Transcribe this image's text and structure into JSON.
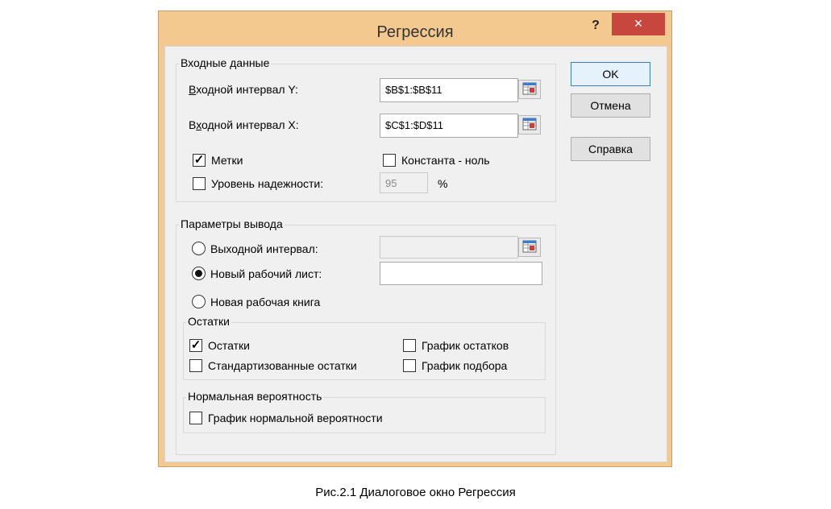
{
  "dialog": {
    "title": "Регрессия",
    "help_glyph": "?",
    "close_glyph": "×"
  },
  "input_group": {
    "label": "Входные данные",
    "y_range_label": "Входной интервал Y:",
    "y_range_value": "$B$1:$B$11",
    "x_range_label": "Входной интервал X:",
    "x_range_value": "$C$1:$D$11",
    "labels_label": "Метки",
    "labels_checked": true,
    "constant_zero_label": "Константа - ноль",
    "constant_zero_checked": false,
    "confidence_label": "Уровень надежности:",
    "confidence_checked": false,
    "confidence_value": "95",
    "percent": "%"
  },
  "output_group": {
    "label": "Параметры вывода",
    "output_range_label": "Выходной интервал:",
    "output_range_value": "",
    "new_sheet_label": "Новый рабочий лист:",
    "new_sheet_value": "",
    "new_workbook_label": "Новая рабочая книга",
    "selected": "new_sheet"
  },
  "residuals_group": {
    "label": "Остатки",
    "residuals_label": "Остатки",
    "residuals_checked": true,
    "standardized_label": "Стандартизованные остатки",
    "standardized_checked": false,
    "residual_plots_label": "График остатков",
    "residual_plots_checked": false,
    "line_fit_label": "График подбора",
    "line_fit_checked": false
  },
  "probability_group": {
    "label": "Нормальная вероятность",
    "normal_plot_label": "График нормальной вероятности",
    "normal_plot_checked": false
  },
  "buttons": {
    "ok": "OK",
    "cancel": "Отмена",
    "help": "Справка"
  },
  "caption": "Рис.2.1 Диалоговое окно Регрессия",
  "colors": {
    "frame": "#f3c98f",
    "close": "#c7473f",
    "client": "#f0f0f0"
  }
}
